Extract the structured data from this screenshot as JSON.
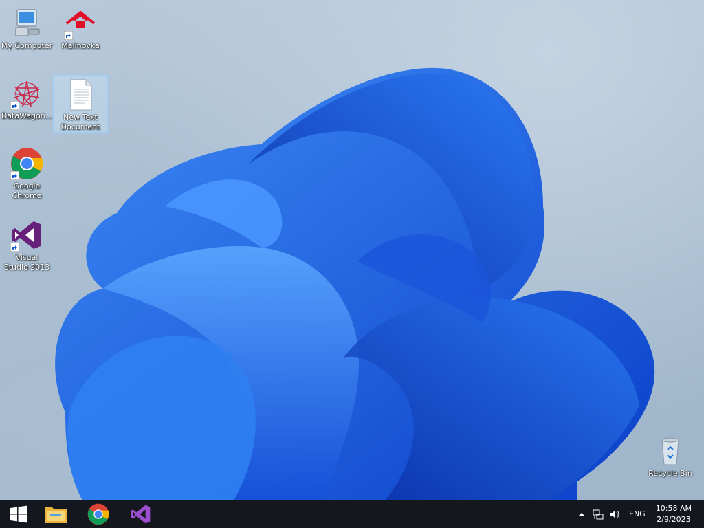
{
  "desktop": {
    "icons": [
      {
        "label": "My Computer"
      },
      {
        "label": "Malinovka"
      },
      {
        "label": "DataWagon..."
      },
      {
        "label": "New Text Document"
      },
      {
        "label": "Google Chrome"
      },
      {
        "label": "Visual Studio 2013"
      },
      {
        "label": "Recycle Bin"
      }
    ]
  },
  "taskbar": {
    "tray": {
      "language": "ENG",
      "time": "10:58 AM",
      "date": "2/9/2023"
    }
  }
}
